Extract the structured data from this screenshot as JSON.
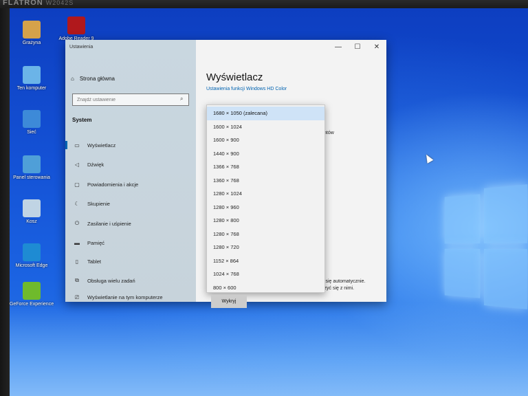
{
  "monitor": {
    "brand": "FLATRON",
    "model": "W2042S"
  },
  "desktop_icons": [
    {
      "label": "Grażyna",
      "color": "#d6a24a"
    },
    {
      "label": "Adobe Reader 9",
      "color": "#b0181c"
    },
    {
      "label": "Ten komputer",
      "color": "#6bb4e8"
    },
    {
      "label": "Sieć",
      "color": "#3d8ad8"
    },
    {
      "label": "Panel sterowania",
      "color": "#4f9fd8"
    },
    {
      "label": "Kosz",
      "color": "#c0d4e4"
    },
    {
      "label": "Microsoft Edge",
      "color": "#1e8bd3"
    },
    {
      "label": "GeForce Experience",
      "color": "#6fba2c"
    }
  ],
  "window": {
    "title": "Ustawienia",
    "controls": {
      "minimize": "—",
      "maximize": "☐",
      "close": "✕"
    }
  },
  "sidebar": {
    "home_label": "Strona główna",
    "search_placeholder": "Znajdź ustawienie",
    "section_title": "System",
    "items": [
      {
        "label": "Wyświetlacz",
        "icon": "monitor-icon",
        "glyph": "▭"
      },
      {
        "label": "Dźwięk",
        "icon": "speaker-icon",
        "glyph": "◁"
      },
      {
        "label": "Powiadomienia i akcje",
        "icon": "notification-icon",
        "glyph": "▢"
      },
      {
        "label": "Skupienie",
        "icon": "moon-icon",
        "glyph": "☾"
      },
      {
        "label": "Zasilanie i uśpienie",
        "icon": "power-icon",
        "glyph": "⏻"
      },
      {
        "label": "Pamięć",
        "icon": "storage-icon",
        "glyph": "▬"
      },
      {
        "label": "Tablet",
        "icon": "tablet-icon",
        "glyph": "▯"
      },
      {
        "label": "Obsługa wielu zadań",
        "icon": "multitask-icon",
        "glyph": "⧉"
      },
      {
        "label": "Wyświetlanie na tym komputerze",
        "icon": "project-icon",
        "glyph": "⎚"
      }
    ]
  },
  "main": {
    "title": "Wyświetlacz",
    "hd_link": "Ustawienia funkcji Windows HD Color",
    "fragment_1": "ntów",
    "fragment_2": "y się automatycznie.",
    "fragment_3": "czyć się z nimi.",
    "detect_button": "Wykryj"
  },
  "resolution_dropdown": {
    "selected_index": 0,
    "options": [
      "1680 × 1050 (zalecana)",
      "1600 × 1024",
      "1600 × 900",
      "1440 × 900",
      "1366 × 768",
      "1360 × 768",
      "1280 × 1024",
      "1280 × 960",
      "1280 × 800",
      "1280 × 768",
      "1280 × 720",
      "1152 × 864",
      "1024 × 768",
      "800 × 600"
    ]
  }
}
